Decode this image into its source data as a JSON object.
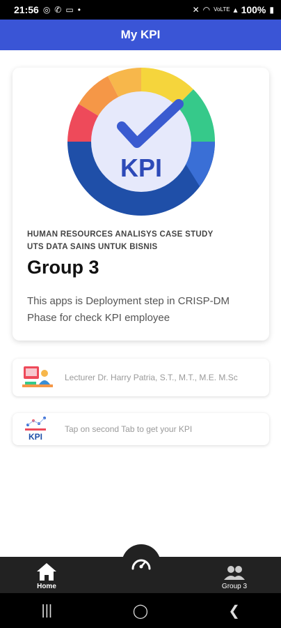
{
  "status_bar": {
    "time": "21:56",
    "battery": "100%",
    "left_icons": [
      "dot-icon",
      "instagram-icon",
      "whatsapp-icon",
      "laptop-icon",
      "dot-icon"
    ],
    "right_icons": [
      "mute-icon",
      "wifi-icon",
      "volte-icon",
      "signal-icon",
      "battery-icon"
    ]
  },
  "app_bar": {
    "title": "My KPI"
  },
  "main_card": {
    "subtitle_line1": "HUMAN RESOURCES ANALISYS CASE STUDY",
    "subtitle_line2": "UTS DATA SAINS UNTUK BISNIS",
    "title": "Group 3",
    "description": "This apps is Deployment step in CRISP-DM Phase for check KPI employee",
    "logo_text": "KPI"
  },
  "info_cards": [
    {
      "text": "Lecturer Dr. Harry Patria, S.T., M.T., M.E. M.Sc",
      "icon": "lecturer-icon"
    },
    {
      "text": "Tap on second Tab to get your KPI",
      "icon": "kpi-chart-icon",
      "icon_text": "KPI"
    }
  ],
  "bottom_nav": {
    "home_label": "Home",
    "group_label": "Group 3",
    "center_icon": "speedometer-icon"
  },
  "colors": {
    "primary": "#3a55d6",
    "nav_bg": "#222222",
    "logo_dark_blue": "#1f4fa8",
    "logo_inner": "#e6e9fb"
  }
}
